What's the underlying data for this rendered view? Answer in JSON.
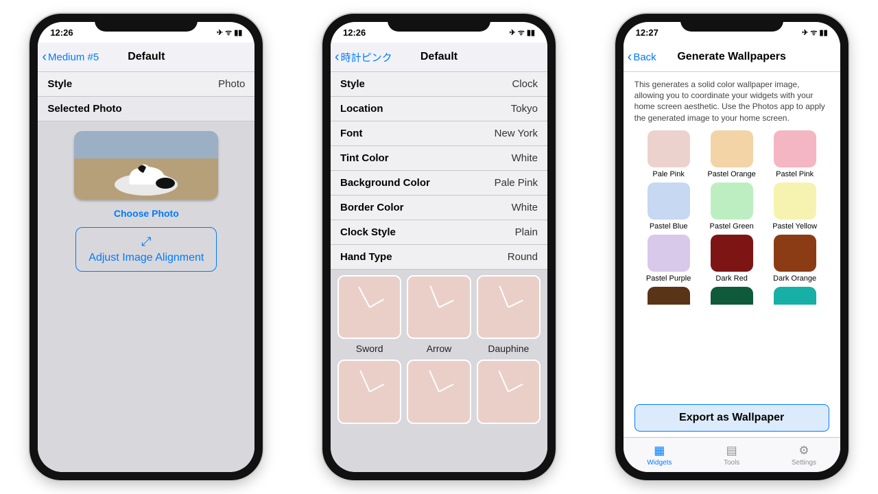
{
  "phone1": {
    "time": "12:26",
    "back": "Medium #5",
    "title": "Default",
    "rows": {
      "style_k": "Style",
      "style_v": "Photo",
      "selected": "Selected Photo"
    },
    "choose": "Choose Photo",
    "adjust": "Adjust Image Alignment"
  },
  "phone2": {
    "time": "12:26",
    "back": "時計ピンク",
    "title": "Default",
    "rows": {
      "style_k": "Style",
      "style_v": "Clock",
      "loc_k": "Location",
      "loc_v": "Tokyo",
      "font_k": "Font",
      "font_v": "New York",
      "tint_k": "Tint Color",
      "tint_v": "White",
      "bg_k": "Background Color",
      "bg_v": "Pale Pink",
      "bord_k": "Border Color",
      "bord_v": "White",
      "cs_k": "Clock Style",
      "cs_v": "Plain",
      "ht_k": "Hand Type",
      "ht_v": "Round"
    },
    "hands": {
      "a": "Sword",
      "b": "Arrow",
      "c": "Dauphine"
    }
  },
  "phone3": {
    "time": "12:27",
    "back": "Back",
    "title": "Generate Wallpapers",
    "desc": "This generates a solid color wallpaper image, allowing you to coordinate your widgets with your home screen aesthetic.  Use the Photos app to apply the generated image to your home screen.",
    "swatches": [
      {
        "l": "Pale Pink",
        "c": "#ecd2cd"
      },
      {
        "l": "Pastel Orange",
        "c": "#f3d4a6"
      },
      {
        "l": "Pastel Pink",
        "c": "#f5b6c4"
      },
      {
        "l": "Pastel Blue",
        "c": "#c6d8f2"
      },
      {
        "l": "Pastel Green",
        "c": "#bdeec2"
      },
      {
        "l": "Pastel Yellow",
        "c": "#f6f3b0"
      },
      {
        "l": "Pastel Purple",
        "c": "#d8c8ea"
      },
      {
        "l": "Dark Red",
        "c": "#7e1515"
      },
      {
        "l": "Dark Orange",
        "c": "#8c3c15"
      }
    ],
    "swatches_cut": [
      {
        "c": "#5a3417"
      },
      {
        "c": "#0e5a3a"
      },
      {
        "c": "#17b0a7"
      }
    ],
    "export": "Export as Wallpaper",
    "tabs": {
      "widgets": "Widgets",
      "tools": "Tools",
      "settings": "Settings"
    }
  }
}
